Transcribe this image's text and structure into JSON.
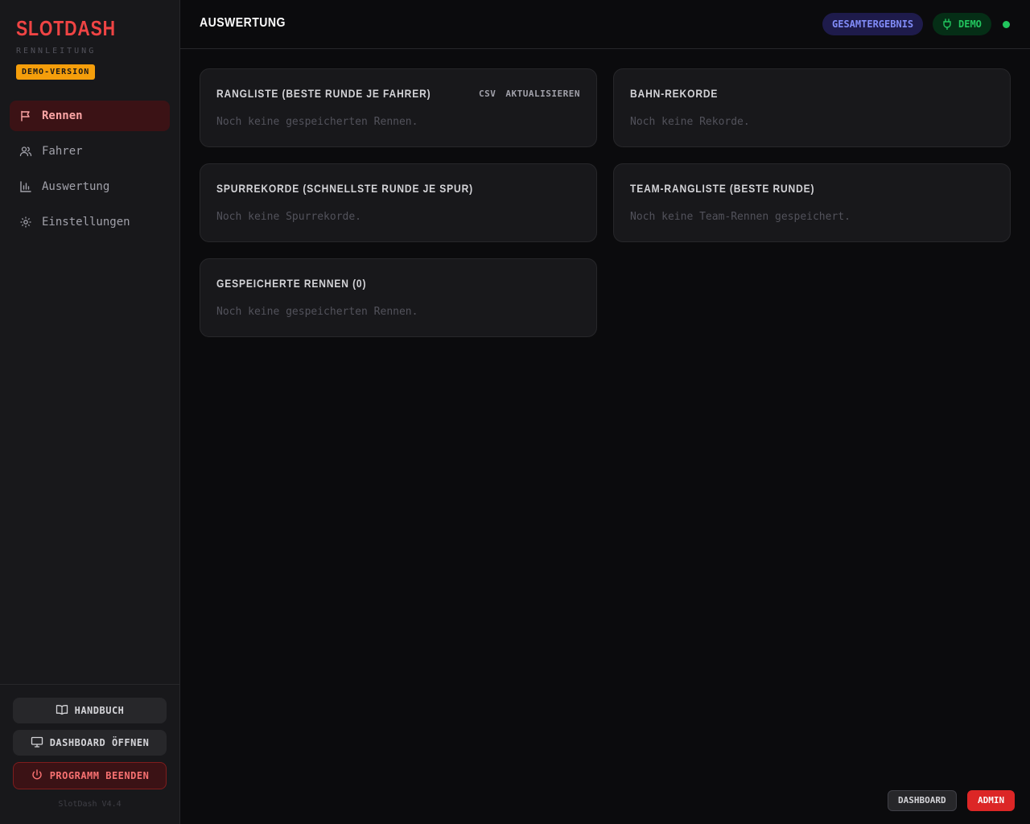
{
  "sidebar": {
    "brand": "SLOTDASH",
    "subtitle": "RENNLEITUNG",
    "demo_badge": "DEMO-VERSION",
    "nav": [
      {
        "label": "Rennen",
        "icon": "flag-icon"
      },
      {
        "label": "Fahrer",
        "icon": "users-icon"
      },
      {
        "label": "Auswertung",
        "icon": "bar-chart-icon"
      },
      {
        "label": "Einstellungen",
        "icon": "gear-icon"
      }
    ],
    "footer": {
      "handbook": "HANDBUCH",
      "open_dashboard": "DASHBOARD ÖFFNEN",
      "quit": "PROGRAMM BEENDEN",
      "version": "SlotDash V4.4"
    }
  },
  "header": {
    "title": "AUSWERTUNG",
    "overall_pill": "GESAMTERGEBNIS",
    "demo_pill": "DEMO"
  },
  "cards": [
    {
      "title": "RANGLISTE (BESTE RUNDE JE FAHRER)",
      "empty": "Noch keine gespeicherten Rennen.",
      "actions": [
        "CSV",
        "AKTUALISIEREN"
      ]
    },
    {
      "title": "BAHN-REKORDE",
      "empty": "Noch keine Rekorde."
    },
    {
      "title": "SPURREKORDE (SCHNELLSTE RUNDE JE SPUR)",
      "empty": "Noch keine Spurrekorde."
    },
    {
      "title": "TEAM-RANGLISTE (BESTE RUNDE)",
      "empty": "Noch keine Team-Rennen gespeichert."
    },
    {
      "title": "GESPEICHERTE RENNEN (0)",
      "empty": "Noch keine gespeicherten Rennen."
    }
  ],
  "bottom_buttons": {
    "dashboard": "DASHBOARD",
    "admin": "ADMIN"
  },
  "colors": {
    "accent": "#ef4444",
    "status_online": "#22c55e",
    "badge": "#f59e0b"
  }
}
